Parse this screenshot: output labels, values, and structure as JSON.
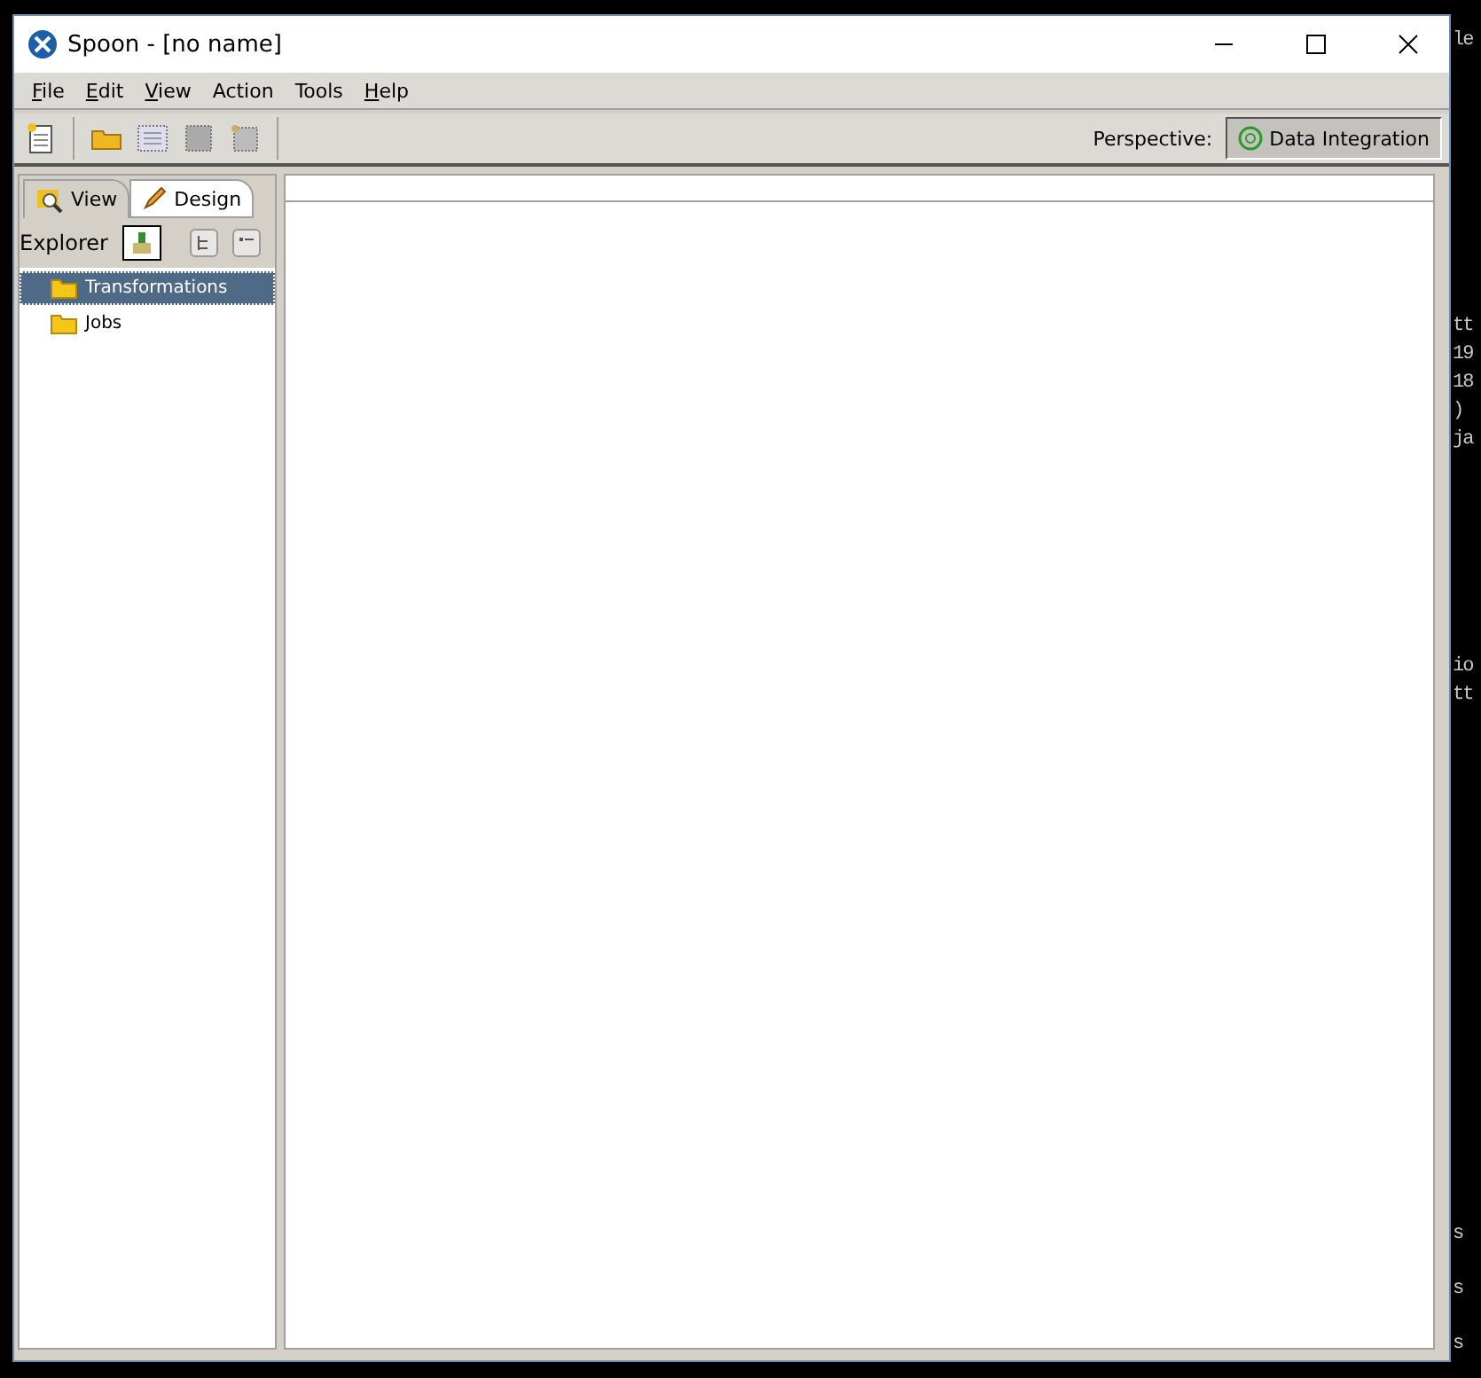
{
  "console_fragments": [
    "le",
    "tt",
    "19",
    "18",
    ")",
    "ja",
    "io",
    "tt",
    "s",
    "s",
    "s"
  ],
  "window": {
    "title": "Spoon - [no name]"
  },
  "menu": [
    {
      "label": "File",
      "mnemonic": true
    },
    {
      "label": "Edit",
      "mnemonic": true
    },
    {
      "label": "View",
      "mnemonic": true
    },
    {
      "label": "Action",
      "mnemonic": false
    },
    {
      "label": "Tools",
      "mnemonic": false
    },
    {
      "label": "Help",
      "mnemonic": true
    }
  ],
  "perspective": {
    "label": "Perspective:",
    "button": "Data Integration",
    "selected": true
  },
  "tabs": [
    {
      "label": "View",
      "selected": true
    },
    {
      "label": "Design",
      "selected": false
    }
  ],
  "explorer": {
    "label": "Explorer"
  },
  "tree": [
    {
      "label": "Transformations",
      "selected": true
    },
    {
      "label": "Jobs",
      "selected": false
    }
  ]
}
